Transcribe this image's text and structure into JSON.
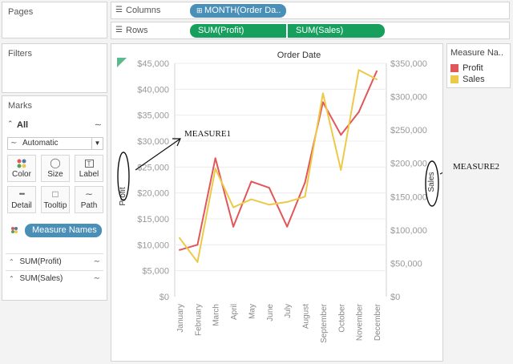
{
  "left": {
    "pages_title": "Pages",
    "filters_title": "Filters",
    "marks_title": "Marks",
    "all_label": "All",
    "mark_type": "Automatic",
    "buttons": [
      {
        "label": "Color",
        "icon": "color-dots-icon"
      },
      {
        "label": "Size",
        "icon": "size-icon"
      },
      {
        "label": "Label",
        "icon": "label-icon"
      },
      {
        "label": "Detail",
        "icon": "detail-icon"
      },
      {
        "label": "Tooltip",
        "icon": "tooltip-icon"
      },
      {
        "label": "Path",
        "icon": "path-icon"
      }
    ],
    "measure_names_pill": "Measure Names",
    "sum_profit": "SUM(Profit)",
    "sum_sales": "SUM(Sales)"
  },
  "shelves": {
    "columns_label": "Columns",
    "columns_pill": "MONTH(Order Da..",
    "rows_label": "Rows",
    "rows_pill_1": "SUM(Profit)",
    "rows_pill_2": "SUM(Sales)"
  },
  "legend": {
    "title": "Measure Na..",
    "items": [
      {
        "label": "Profit",
        "color": "#e15759"
      },
      {
        "label": "Sales",
        "color": "#edc948"
      }
    ]
  },
  "annotations": {
    "measure1": "MEASURE1",
    "measure2": "MEASURE2"
  },
  "chart_data": {
    "type": "line",
    "title": "Order Date",
    "categories": [
      "January",
      "February",
      "March",
      "April",
      "May",
      "June",
      "July",
      "August",
      "September",
      "October",
      "November",
      "December"
    ],
    "series": [
      {
        "name": "Profit",
        "axis": "left",
        "color": "#e15759",
        "values": [
          9000,
          10000,
          26700,
          13500,
          22200,
          21000,
          13500,
          22000,
          37500,
          31200,
          35600,
          43500
        ]
      },
      {
        "name": "Sales",
        "axis": "right",
        "color": "#edc948",
        "values": [
          88000,
          52000,
          192000,
          134000,
          146000,
          138000,
          142000,
          150000,
          305000,
          190000,
          340000,
          326000
        ]
      }
    ],
    "ylabel_left": "Profit",
    "ylabel_right": "Sales",
    "ylim_left": [
      0,
      45000
    ],
    "ylim_right": [
      0,
      350000
    ],
    "yticks_left": [
      "$0",
      "$5,000",
      "$10,000",
      "$15,000",
      "$20,000",
      "$25,000",
      "$30,000",
      "$35,000",
      "$40,000",
      "$45,000"
    ],
    "yticks_right": [
      "$0",
      "$50,000",
      "$100,000",
      "$150,000",
      "$200,000",
      "$250,000",
      "$300,000",
      "$350,000"
    ],
    "grid": true
  }
}
